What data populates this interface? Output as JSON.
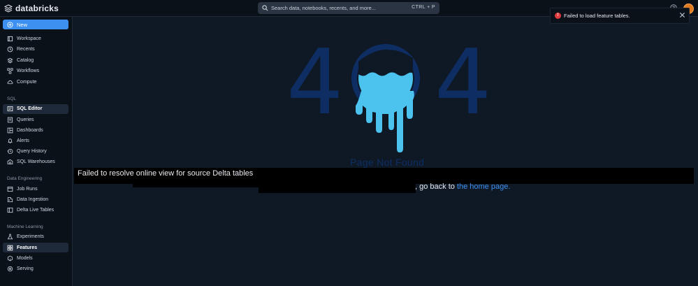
{
  "brand": {
    "name": "databricks"
  },
  "search": {
    "placeholder": "Search data, notebooks, recents, and more...",
    "shortcut": "CTRL + P"
  },
  "sidebar": {
    "new_label": "New",
    "main_items": [
      "Workspace",
      "Recents",
      "Catalog",
      "Workflows",
      "Compute"
    ],
    "sections": [
      {
        "title": "SQL",
        "items": [
          "SQL Editor",
          "Queries",
          "Dashboards",
          "Alerts",
          "Query History",
          "SQL Warehouses"
        ]
      },
      {
        "title": "Data Engineering",
        "items": [
          "Job Runs",
          "Data Ingestion",
          "Delta Live Tables"
        ]
      },
      {
        "title": "Machine Learning",
        "items": [
          "Experiments",
          "Features",
          "Models",
          "Serving"
        ]
      }
    ]
  },
  "toast": {
    "message": "Failed to load feature tables."
  },
  "page": {
    "digit_left": "4",
    "digit_right": "4",
    "not_found": "Page Not Found",
    "error_message": "Failed to resolve online view for source Delta tables",
    "back_prefix": ", go back to ",
    "home_link": "the home page."
  },
  "colors": {
    "accent": "#3d8ff0",
    "error": "#e0393e",
    "background": "#0f1825",
    "sidebar": "#0b1119",
    "avatar": "#e07b1f"
  },
  "icons": {
    "search": "search-icon",
    "help": "help-icon",
    "new": "plus-circle-icon",
    "close": "close-icon",
    "workspace": "workspace-icon",
    "recents": "clock-icon",
    "catalog": "catalog-icon",
    "workflows": "workflows-icon",
    "compute": "cloud-icon"
  }
}
